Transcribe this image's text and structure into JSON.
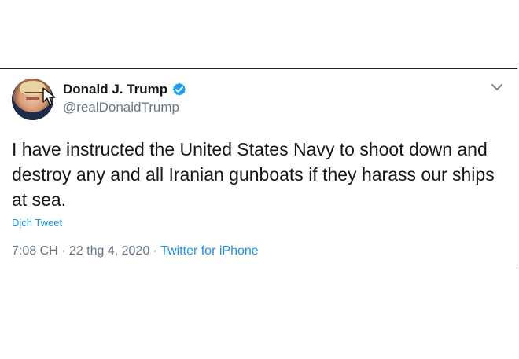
{
  "tweet": {
    "display_name": "Donald J. Trump",
    "handle": "@realDonaldTrump",
    "text": "I have instructed the United States Navy to shoot down and destroy any and all Iranian gunboats if they harass our ships at sea.",
    "translate_label": "Dịch Tweet",
    "timestamp": "7:08 CH · 22 thg 4, 2020",
    "separator": " · ",
    "source": "Twitter for iPhone"
  },
  "icons": {
    "avatar": "profile-photo",
    "verified": "verified-badge-icon",
    "menu": "chevron-down-icon",
    "pointer": "mouse-cursor-icon"
  },
  "colors": {
    "text": "#14171a",
    "secondary": "#657786",
    "link": "#1b95e0",
    "verified": "#1da1f2",
    "border": "#222222"
  }
}
